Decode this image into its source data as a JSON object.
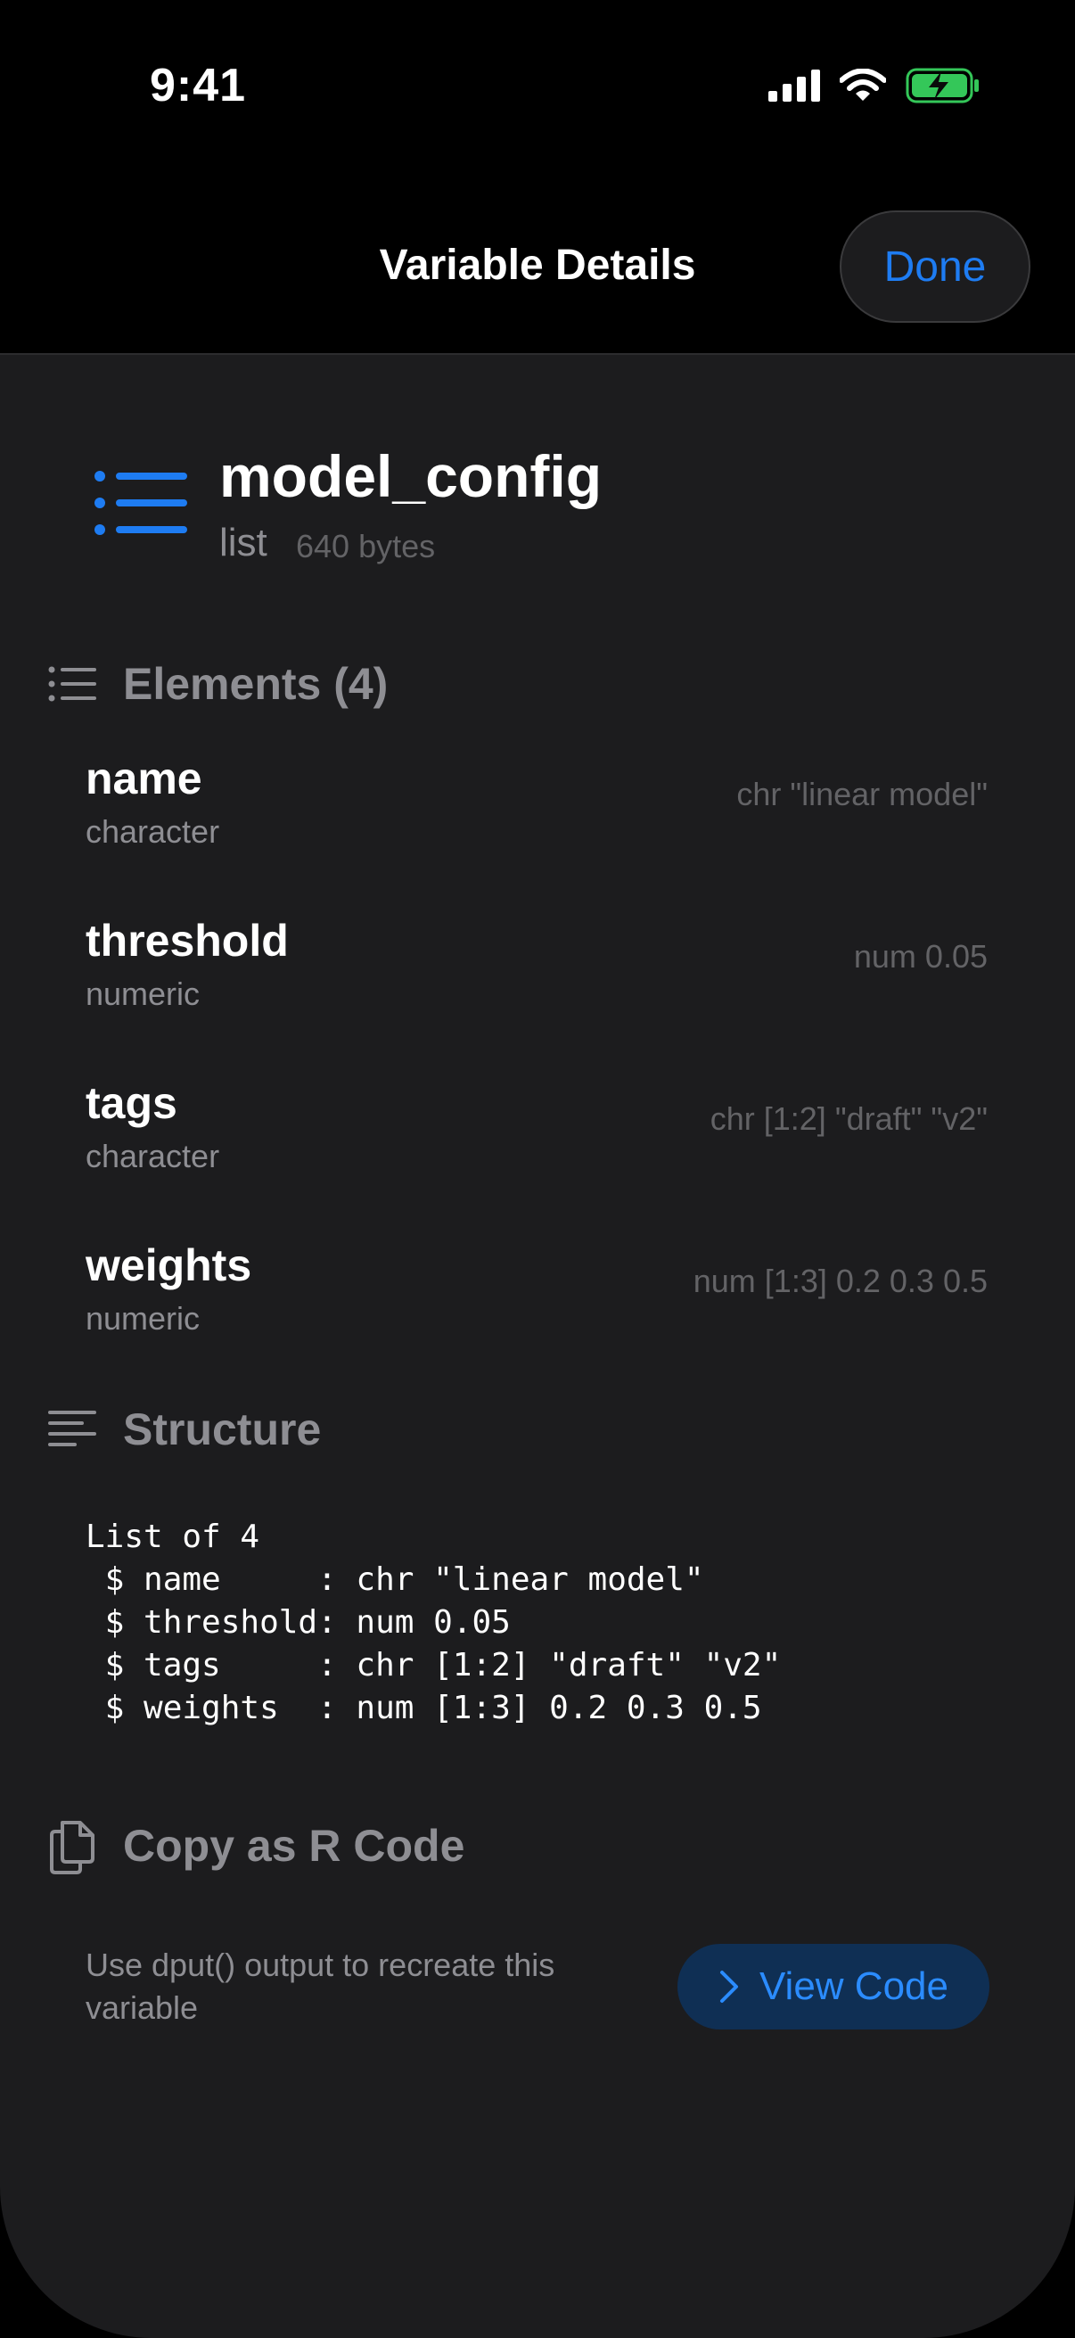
{
  "status_bar": {
    "time": "9:41"
  },
  "nav": {
    "title": "Variable Details",
    "done_label": "Done"
  },
  "variable": {
    "name": "model_config",
    "type": "list",
    "size": "640 bytes"
  },
  "elements_section": {
    "title": "Elements (4)",
    "items": [
      {
        "name": "name",
        "class": "character",
        "value": "chr \"linear model\""
      },
      {
        "name": "threshold",
        "class": "numeric",
        "value": "num 0.05"
      },
      {
        "name": "tags",
        "class": "character",
        "value": "chr [1:2] \"draft\" \"v2\""
      },
      {
        "name": "weights",
        "class": "numeric",
        "value": "num [1:3] 0.2 0.3 0.5"
      }
    ]
  },
  "structure_section": {
    "title": "Structure",
    "text": "List of 4\n $ name     : chr \"linear model\"\n $ threshold: num 0.05\n $ tags     : chr [1:2] \"draft\" \"v2\"\n $ weights  : num [1:3] 0.2 0.3 0.5"
  },
  "copy_section": {
    "title": "Copy as R Code",
    "description": "Use dput() output to recreate this variable",
    "button_label": "View Code"
  },
  "colors": {
    "accent": "#1e7cf2",
    "sheet_background": "#1c1c1e",
    "battery_green": "#34c759"
  },
  "icons": {
    "variable": "list-bullet-icon",
    "elements": "list-icon",
    "structure": "text-align-left-icon",
    "copy": "doc-on-doc-icon",
    "view_code": "chevron-right-icon"
  }
}
